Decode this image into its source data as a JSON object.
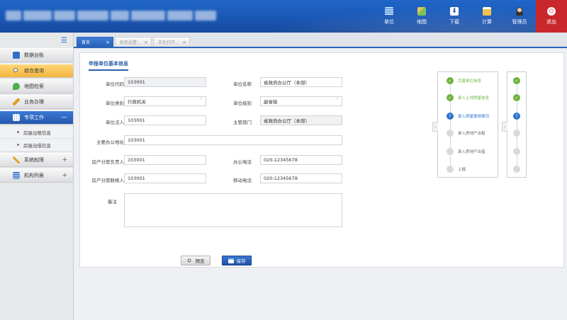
{
  "header": {
    "nav": [
      {
        "name": "nav-unit",
        "label": "单位",
        "color": "#9fd3ff"
      },
      {
        "name": "nav-map",
        "label": "地图",
        "color": "#9ad07a"
      },
      {
        "name": "nav-download",
        "label": "下载",
        "color": "#ffffff"
      },
      {
        "name": "nav-calculate",
        "label": "计算",
        "color": "#f2c14e"
      },
      {
        "name": "nav-admin",
        "label": "管理员",
        "color": "#f2c7a0"
      },
      {
        "name": "nav-logout",
        "label": "退出",
        "color": "#ffffff"
      }
    ]
  },
  "sidebar": {
    "items": [
      {
        "label": "数据台账"
      },
      {
        "label": "综合查询"
      },
      {
        "label": "地图检索"
      },
      {
        "label": "业务办理"
      },
      {
        "label": "专项工作",
        "toggle": "—"
      },
      {
        "label": "房屋出租信息"
      },
      {
        "label": "房屋出借信息"
      },
      {
        "label": "系统权限",
        "toggle": "+"
      },
      {
        "label": "机构列表",
        "toggle": "+"
      }
    ]
  },
  "tabs": [
    {
      "label": "首页"
    },
    {
      "label": "机构设置..."
    },
    {
      "label": "正在打开..."
    }
  ],
  "form": {
    "title": "申报单位基本信息",
    "fields": {
      "unit_code": {
        "label": "单位代码",
        "value": "103001"
      },
      "unit_name": {
        "label": "单位名称",
        "value": "省政府办公厅（本部）"
      },
      "unit_type": {
        "label": "单位类别",
        "value": "行政机关"
      },
      "unit_level": {
        "label": "单位级别",
        "value": "副省级"
      },
      "legal_person": {
        "label": "单位法人",
        "value": "103001"
      },
      "authority": {
        "label": "主管部门",
        "value": "省政府办公厅（本部）"
      },
      "office_address": {
        "label": "主要办公地址",
        "value": "103001"
      },
      "house_manager": {
        "label": "房产分管负责人",
        "value": "103001"
      },
      "office_phone": {
        "label": "办公电话",
        "value": "020-12345678"
      },
      "house_contact": {
        "label": "房产分管联络人",
        "value": "103001"
      },
      "mobile_phone": {
        "label": "移动电话",
        "value": "020-12345678"
      },
      "remark": {
        "label": "备注",
        "value": ""
      }
    },
    "buttons": {
      "preview": "预览",
      "save": "保存"
    }
  },
  "steps": [
    {
      "label": "完善单位信息",
      "state": "done"
    },
    {
      "label": "录入土地房屋信息",
      "state": "done"
    },
    {
      "label": "录入房屋使用情况",
      "state": "current"
    },
    {
      "label": "录入房地产出租",
      "state": "todo"
    },
    {
      "label": "录入房地产出借",
      "state": "todo"
    },
    {
      "label": "上报",
      "state": "todo"
    }
  ],
  "colors": {
    "primary": "#1f66c9",
    "done": "#6db33f",
    "current": "#2a72cf",
    "logout": "#c8282c"
  }
}
